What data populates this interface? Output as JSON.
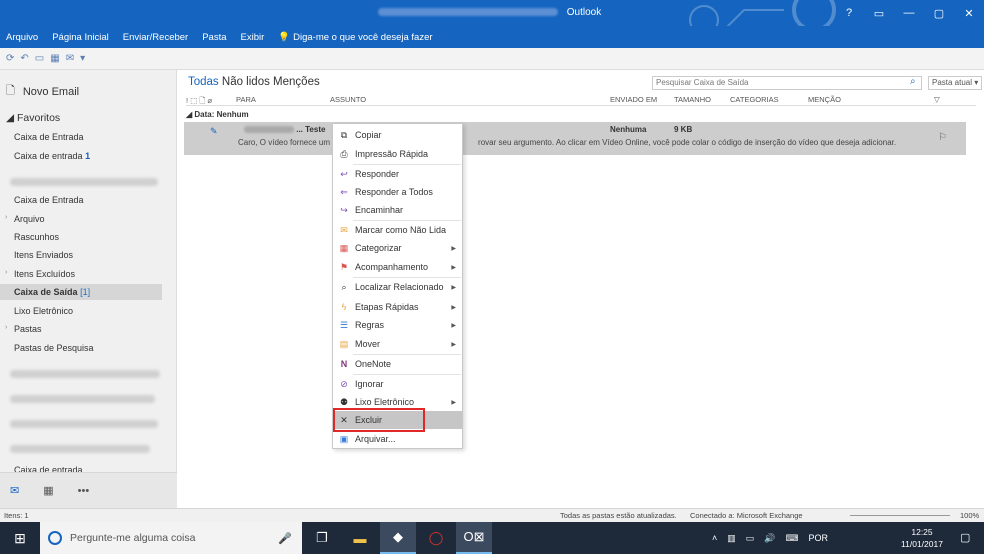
{
  "window": {
    "title": "Outlook",
    "controls": [
      "?",
      "▭",
      "—",
      "▢",
      "✕"
    ]
  },
  "ribbon": {
    "tabs": [
      "Arquivo",
      "Página Inicial",
      "Enviar/Receber",
      "Pasta",
      "Exibir"
    ],
    "tell_me": "Diga-me o que você deseja fazer"
  },
  "nav": {
    "new_email": "Novo Email",
    "favorites_label": "Favoritos",
    "favorites": [
      "Caixa de Entrada",
      "Caixa de entrada"
    ],
    "favorites_count": "1",
    "account_folders": [
      "Caixa de Entrada",
      "Arquivo",
      "Rascunhos",
      "Itens Enviados",
      "Itens Excluídos"
    ],
    "selected_folder": "Caixa de Saída",
    "selected_count": "[1]",
    "more_folders": [
      "Lixo Eletrônico",
      "Pastas",
      "Pastas de Pesquisa"
    ],
    "bottom_item": "Caixa de entrada"
  },
  "main": {
    "filters": {
      "all": "Todas",
      "unread": "Não lidos",
      "mentions": "Menções"
    },
    "search_placeholder": "Pesquisar Caixa de Saída",
    "scope": "Pasta atual",
    "columns": [
      "PARA",
      "ASSUNTO",
      "ENVIADO EM",
      "TAMANHO",
      "CATEGORIAS",
      "MENÇÃO"
    ],
    "group_label": "Data: Nenhum",
    "message": {
      "subject": "... Teste",
      "preview_start": "Caro,  O vídeo fornece um",
      "preview_end": "rovar seu argumento. Ao clicar em Vídeo Online, você pode colar o código de inserção do vídeo que deseja adicionar.",
      "sent": "Nenhuma",
      "size": "9 KB"
    }
  },
  "context_menu": {
    "items": [
      {
        "label": "Copiar",
        "icon": "copy-icon"
      },
      {
        "label": "Impressão Rápida",
        "icon": "print-icon"
      },
      {
        "label": "Responder",
        "icon": "reply-icon"
      },
      {
        "label": "Responder a Todos",
        "icon": "reply-all-icon"
      },
      {
        "label": "Encaminhar",
        "icon": "forward-icon"
      },
      {
        "label": "Marcar como Não Lida",
        "icon": "envelope-icon"
      },
      {
        "label": "Categorizar",
        "icon": "category-icon"
      },
      {
        "label": "Acompanhamento",
        "icon": "flag-icon"
      },
      {
        "label": "Localizar Relacionado",
        "icon": "find-related-icon"
      },
      {
        "label": "Etapas Rápidas",
        "icon": "lightning-icon"
      },
      {
        "label": "Regras",
        "icon": "rules-icon"
      },
      {
        "label": "Mover",
        "icon": "move-icon"
      },
      {
        "label": "OneNote",
        "icon": "onenote-icon"
      },
      {
        "label": "Ignorar",
        "icon": "ignore-icon"
      },
      {
        "label": "Lixo Eletrônico",
        "icon": "junk-icon"
      },
      {
        "label": "Excluir",
        "icon": "delete-icon"
      },
      {
        "label": "Arquivar...",
        "icon": "archive-icon"
      }
    ]
  },
  "status": {
    "items": "Itens: 1",
    "folders": "Todas as pastas estão atualizadas.",
    "connection": "Conectado a: Microsoft Exchange",
    "zoom": "100%"
  },
  "taskbar": {
    "search_placeholder": "Pergunte-me alguma coisa",
    "language": "POR",
    "time": "12:25",
    "date": "11/01/2017"
  },
  "colors": {
    "accent": "#1565c0",
    "selection": "#c6c6c6",
    "highlight": "#e02828"
  }
}
